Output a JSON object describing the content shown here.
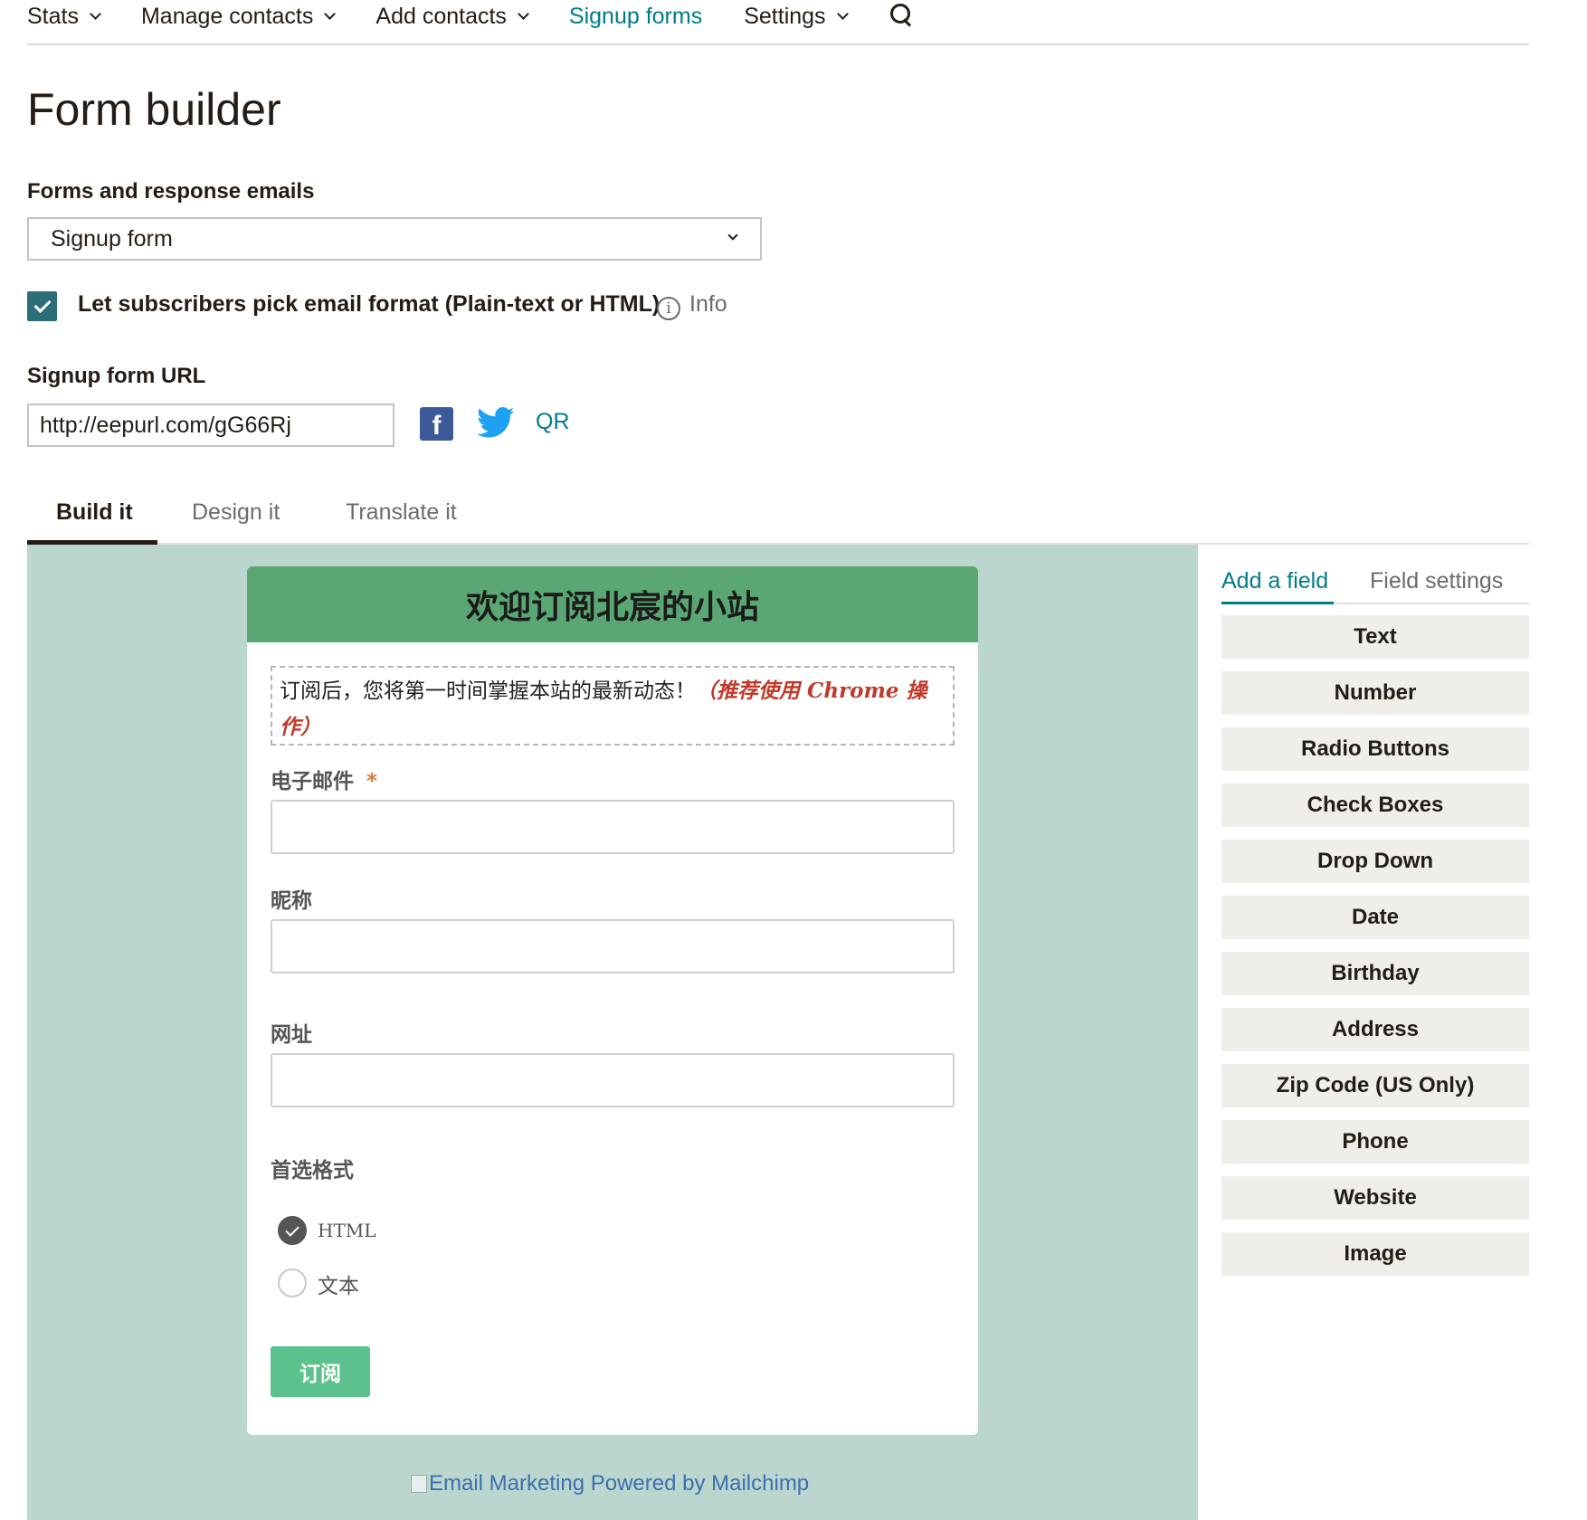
{
  "nav": {
    "items": [
      {
        "label": "Stats",
        "dropdown": true
      },
      {
        "label": "Manage contacts",
        "dropdown": true
      },
      {
        "label": "Add contacts",
        "dropdown": true
      },
      {
        "label": "Signup forms",
        "dropdown": false,
        "active": true
      },
      {
        "label": "Settings",
        "dropdown": true
      }
    ],
    "search_icon": "search-icon"
  },
  "page_title": "Form builder",
  "forms_section": {
    "label": "Forms and response emails",
    "selected": "Signup form"
  },
  "email_format": {
    "checked": true,
    "label": "Let subscribers pick email format (Plain-text or HTML)",
    "info_label": "Info"
  },
  "url_section": {
    "label": "Signup form URL",
    "value": "http://eepurl.com/gG66Rj",
    "qr_label": "QR"
  },
  "tabs": [
    {
      "label": "Build it",
      "active": true
    },
    {
      "label": "Design it",
      "active": false
    },
    {
      "label": "Translate it",
      "active": false
    }
  ],
  "form_preview": {
    "header": "欢迎订阅北宸的小站",
    "intro_text": "订阅后，您将第一时间掌握本站的最新动态！",
    "intro_note": "（推荐使用 Chrome 操作）",
    "fields": [
      {
        "label": "电子邮件",
        "required": true,
        "required_mark": "*"
      },
      {
        "label": "昵称",
        "required": false
      },
      {
        "label": "网址",
        "required": false
      }
    ],
    "format_label": "首选格式",
    "format_options": [
      {
        "label": "HTML",
        "checked": true
      },
      {
        "label": "文本",
        "checked": false
      }
    ],
    "submit_label": "订阅",
    "badge_alt": "Email Marketing Powered by Mailchimp"
  },
  "side_panel": {
    "tabs": [
      {
        "label": "Add a field",
        "active": true
      },
      {
        "label": "Field settings",
        "active": false
      }
    ],
    "field_types": [
      "Text",
      "Number",
      "Radio Buttons",
      "Check Boxes",
      "Drop Down",
      "Date",
      "Birthday",
      "Address",
      "Zip Code (US Only)",
      "Phone",
      "Website",
      "Image"
    ]
  },
  "colors": {
    "accent": "#007c89",
    "form_header": "#5aa773",
    "canvas_bg": "#bad6ce",
    "submit": "#5cc28d",
    "checkbox": "#2c6d7a"
  }
}
